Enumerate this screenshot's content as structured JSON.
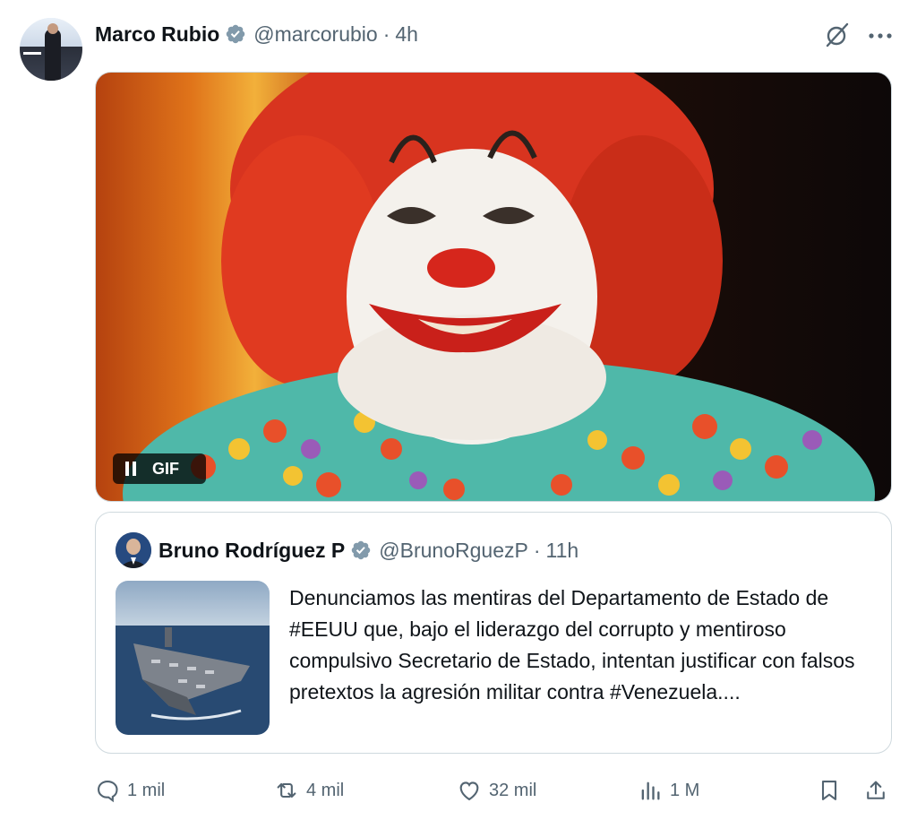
{
  "post": {
    "author_name": "Marco Rubio",
    "handle": "@marcorubio",
    "separator": "·",
    "time": "4h",
    "media_badge": "GIF"
  },
  "quoted_post": {
    "author_name": "Bruno Rodríguez P",
    "handle": "@BrunoRguezP",
    "separator": "·",
    "time": "11h",
    "text": "Denunciamos las mentiras del Departamento de Estado de #EEUU que, bajo el liderazgo del corrupto y mentiroso compulsivo Secretario de Estado, intentan justificar con falsos pretextos la agresión militar contra #Venezuela...."
  },
  "actions": {
    "replies": "1 mil",
    "reposts": "4 mil",
    "likes": "32 mil",
    "views": "1 M"
  },
  "icons": [
    "verified-badge-icon",
    "grok-icon",
    "more-icon",
    "pause-icon",
    "reply-icon",
    "repost-icon",
    "like-icon",
    "views-icon",
    "bookmark-icon",
    "share-icon"
  ],
  "colors": {
    "text_primary": "#0f1419",
    "text_secondary": "#536471",
    "border": "#cfd9de",
    "verified_badge": "#829aab"
  }
}
